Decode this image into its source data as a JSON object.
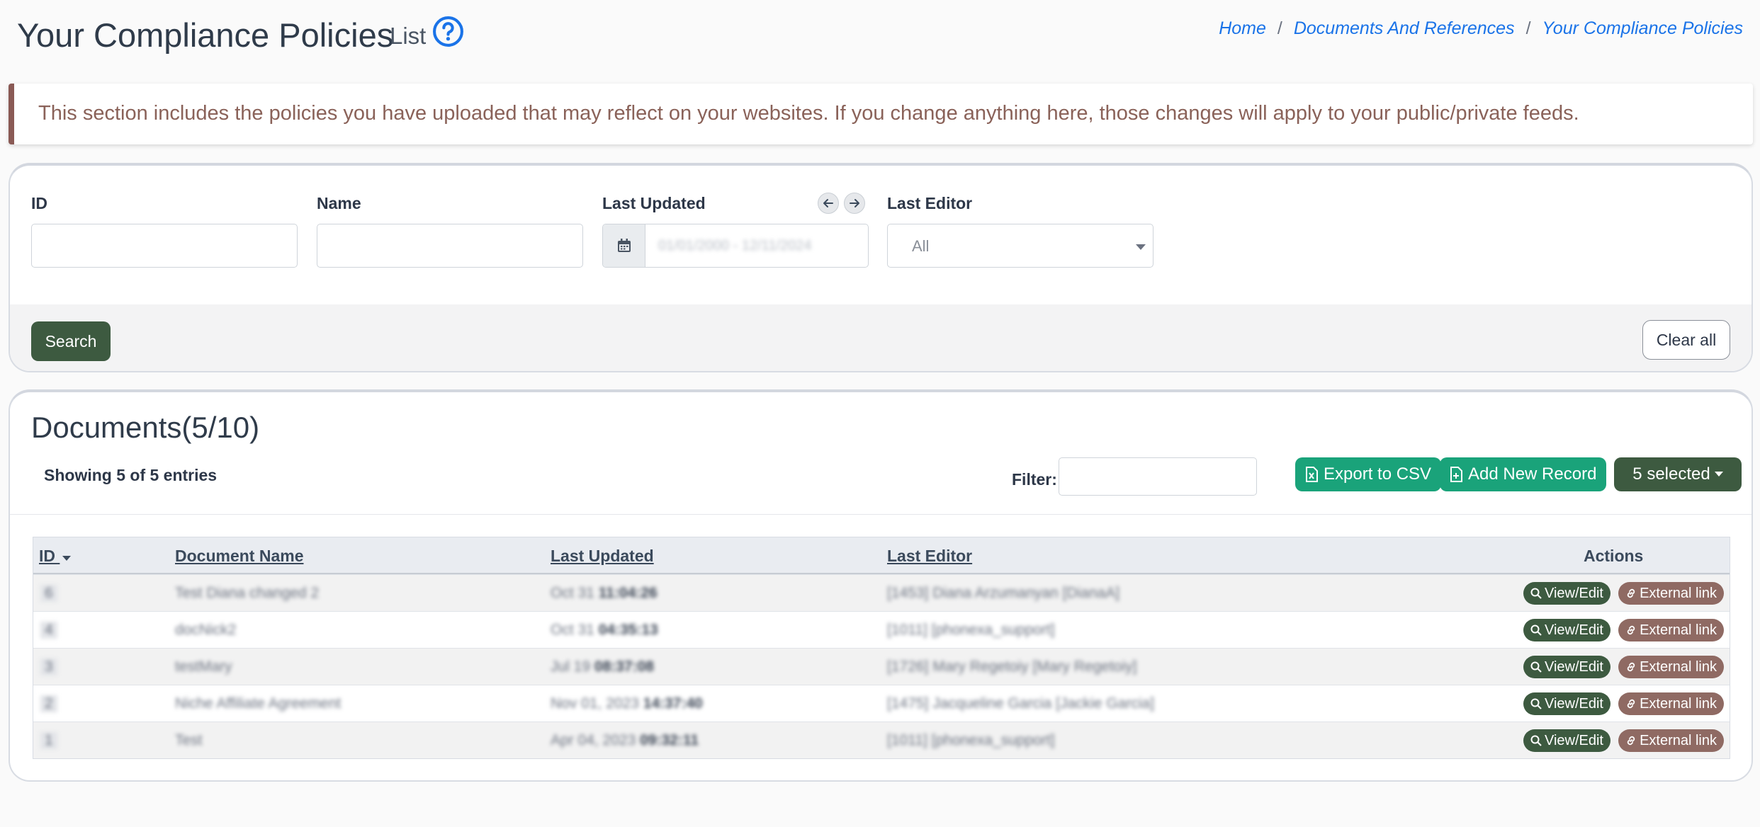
{
  "header": {
    "title": "Your Compliance Policies",
    "subtitle": "List",
    "breadcrumb": [
      "Home",
      "Documents And References",
      "Your Compliance Policies"
    ]
  },
  "alert": {
    "text": "This section includes the policies you have uploaded that may reflect on your websites. If you change anything here, those changes will apply to your public/private feeds."
  },
  "filters": {
    "id_label": "ID",
    "name_label": "Name",
    "last_updated_label": "Last Updated",
    "last_updated_value": "01/01/2000 - 12/11/2024",
    "last_editor_label": "Last Editor",
    "last_editor_value": "All",
    "search_label": "Search",
    "clear_label": "Clear all"
  },
  "documents": {
    "title": "Documents(5/10)",
    "showing": "Showing 5 of 5 entries",
    "filter_label": "Filter:",
    "export_label": "Export to CSV",
    "add_label": "Add New Record",
    "selected_label": "5 selected",
    "columns": [
      "ID",
      "Document Name",
      "Last Updated",
      "Last Editor",
      "Actions"
    ],
    "rows": [
      {
        "id": "6",
        "name": "Test Diana changed 2",
        "updated_date": "Oct 31",
        "updated_time": "11:04:26",
        "editor": "[1453] Diana Arzumanyan [DianaA]"
      },
      {
        "id": "4",
        "name": "docNick2",
        "updated_date": "Oct 31",
        "updated_time": "04:35:13",
        "editor": "[1011] [phonexa_support]"
      },
      {
        "id": "3",
        "name": "testMary",
        "updated_date": "Jul 19",
        "updated_time": "08:37:08",
        "editor": "[1726] Mary Regetoiy [Mary Regetoiy]"
      },
      {
        "id": "2",
        "name": "Niche Affiliate Agreement",
        "updated_date": "Nov 01, 2023",
        "updated_time": "14:37:40",
        "editor": "[1475] Jacqueline Garcia [Jackie Garcia]"
      },
      {
        "id": "1",
        "name": "Test",
        "updated_date": "Apr 04, 2023",
        "updated_time": "09:32:11",
        "editor": "[1011] [phonexa_support]"
      }
    ],
    "view_label": "View/Edit",
    "external_label": "External link"
  }
}
